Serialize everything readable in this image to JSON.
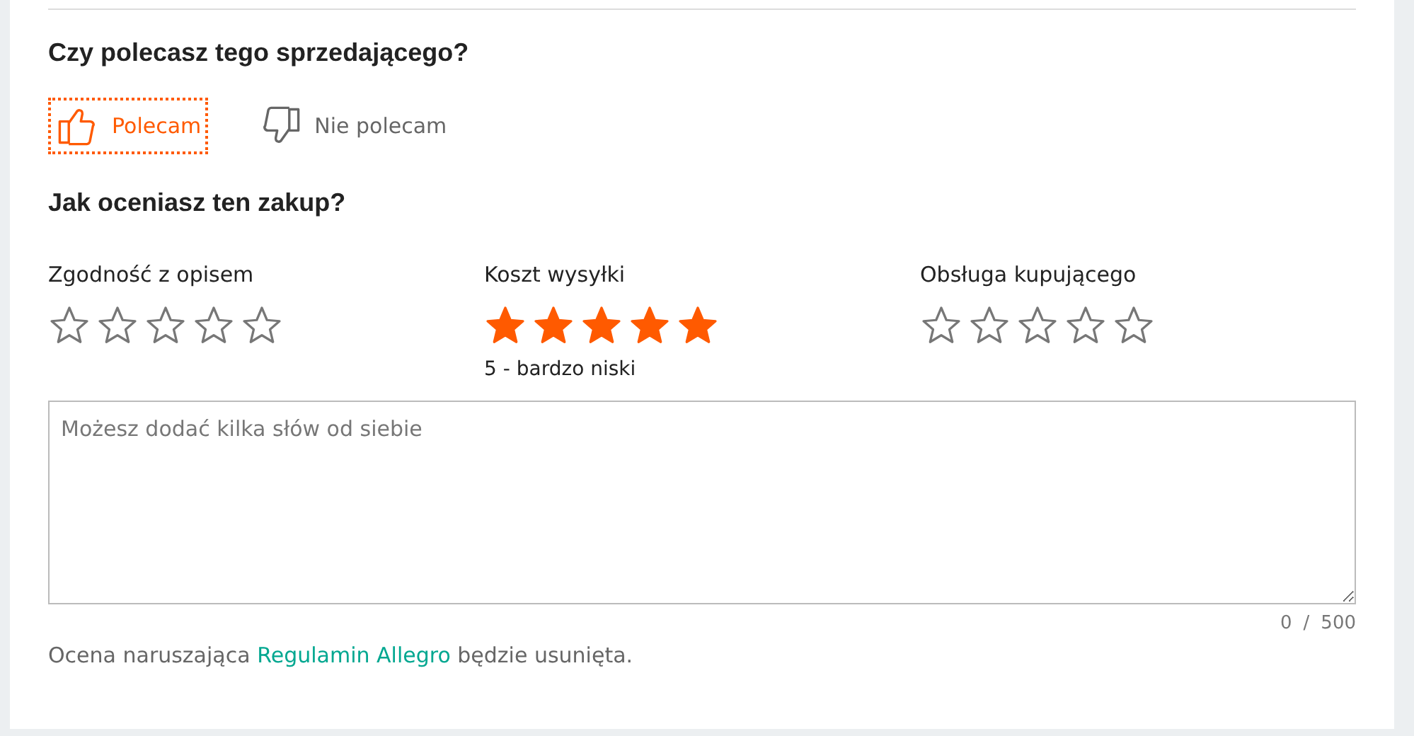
{
  "recommend": {
    "question": "Czy polecasz tego sprzedającego?",
    "options": [
      {
        "kind": "up",
        "label": "Polecam",
        "selected": true
      },
      {
        "kind": "down",
        "label": "Nie polecam",
        "selected": false
      }
    ]
  },
  "rating": {
    "question": "Jak oceniasz ten zakup?",
    "criteria": [
      {
        "label": "Zgodność z opisem",
        "stars": 0
      },
      {
        "label": "Koszt wysyłki",
        "stars": 5,
        "caption": "5 - bardzo niski"
      },
      {
        "label": "Obsługa kupującego",
        "stars": 0
      }
    ]
  },
  "comment": {
    "placeholder": "Możesz dodać kilka słów od siebie",
    "count": "0",
    "separator": "/",
    "max": "500"
  },
  "notice": {
    "before": "Ocena naruszająca",
    "link": "Regulamin Allegro",
    "after": "będzie usunięta."
  }
}
